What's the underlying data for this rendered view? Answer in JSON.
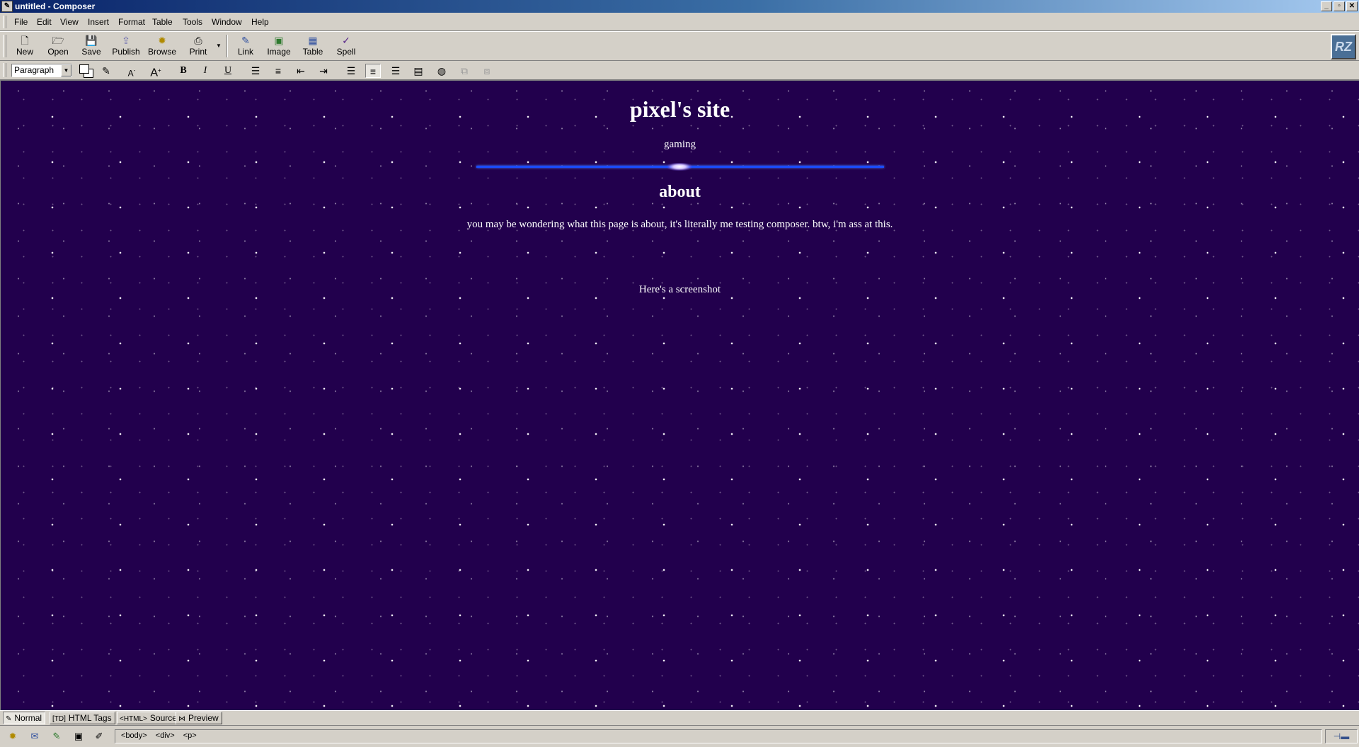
{
  "window": {
    "title": "untitled - Composer",
    "app_icon": "composer-icon",
    "controls": [
      "minimize",
      "restore",
      "close"
    ]
  },
  "menu": [
    "File",
    "Edit",
    "View",
    "Insert",
    "Format",
    "Table",
    "Tools",
    "Window",
    "Help"
  ],
  "toolbar": {
    "new": "New",
    "open": "Open",
    "save": "Save",
    "publish": "Publish",
    "browse": "Browse",
    "print": "Print",
    "link": "Link",
    "image": "Image",
    "table": "Table",
    "spell": "Spell"
  },
  "format": {
    "paragraph_style": "Paragraph",
    "bold": "B",
    "italic": "I",
    "underline": "U",
    "text_color": "#ffffff",
    "background_color": "#ffffff",
    "active_alignment": "center"
  },
  "page": {
    "title": "pixel's site",
    "subtitle": "gaming",
    "about_heading": "about",
    "about_text": "you may be wondering what this page is about, it's literally me testing composer. btw, i'm ass at this.",
    "screenshot_caption": "Here's a screenshot",
    "background_color": "#22004d",
    "rule_color": "#1a4cff"
  },
  "tabs": {
    "normal": "Normal",
    "html_tags": "HTML Tags",
    "source": "Source",
    "preview": "Preview"
  },
  "status": {
    "crumbs": [
      "<body>",
      "<div>",
      "<p>"
    ]
  }
}
